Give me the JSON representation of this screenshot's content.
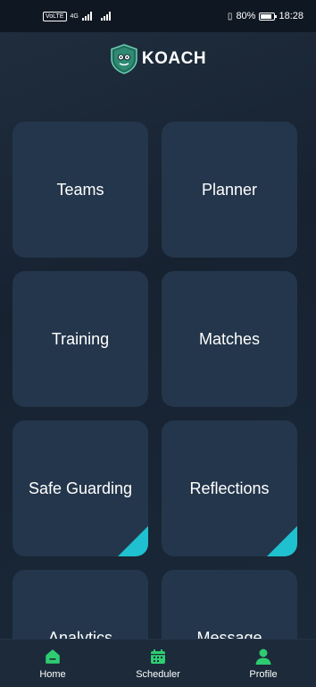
{
  "status_bar": {
    "carrier_badge": "VoLTE",
    "network": "4G",
    "battery_text": "80%",
    "battery_level": 0.8,
    "time": "18:28"
  },
  "header": {
    "app_name": "KOACH",
    "logo_icon": "shield-logo-icon"
  },
  "tiles": [
    {
      "label": "Teams",
      "corner": false
    },
    {
      "label": "Planner",
      "corner": false
    },
    {
      "label": "Training",
      "corner": false
    },
    {
      "label": "Matches",
      "corner": false
    },
    {
      "label": "Safe Guarding",
      "corner": true
    },
    {
      "label": "Reflections",
      "corner": true
    },
    {
      "label": "Analytics",
      "corner": false
    },
    {
      "label": "Message",
      "corner": false
    }
  ],
  "bottom_nav": [
    {
      "label": "Home",
      "icon": "home-icon"
    },
    {
      "label": "Scheduler",
      "icon": "calendar-icon"
    },
    {
      "label": "Profile",
      "icon": "user-icon"
    }
  ],
  "colors": {
    "accent": "#2ecc71",
    "corner": "#1fc0cf",
    "tile": "#24364b",
    "background": "#172231"
  }
}
